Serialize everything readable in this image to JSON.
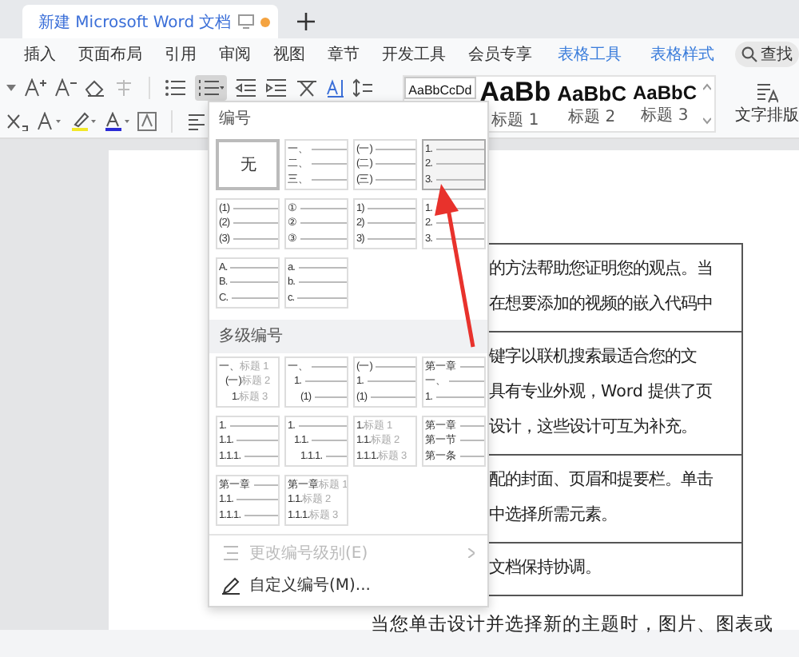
{
  "tab": {
    "title": "新建 Microsoft Word 文档",
    "unsaved": true
  },
  "menu": [
    {
      "label": "插入",
      "kind": "plain"
    },
    {
      "label": "页面布局",
      "kind": "plain"
    },
    {
      "label": "引用",
      "kind": "plain"
    },
    {
      "label": "审阅",
      "kind": "plain"
    },
    {
      "label": "视图",
      "kind": "plain"
    },
    {
      "label": "章节",
      "kind": "plain"
    },
    {
      "label": "开发工具",
      "kind": "plain"
    },
    {
      "label": "会员专享",
      "kind": "plain"
    },
    {
      "label": "表格工具",
      "kind": "context"
    },
    {
      "label": "表格样式",
      "kind": "context"
    }
  ],
  "search": {
    "label": "查找"
  },
  "toolbar": {
    "numbering_open": true
  },
  "styles": [
    {
      "sample": "AaBbCcDd",
      "kind": "normal",
      "selected": true
    },
    {
      "sample": "AaBb",
      "name": "标题 1",
      "kind": "h1",
      "selected": false
    },
    {
      "sample": "AaBbC",
      "name": "标题 2",
      "kind": "h2",
      "selected": false
    },
    {
      "sample": "AaBbC",
      "name": "标题 3",
      "kind": "h3",
      "selected": false
    }
  ],
  "text_layout": {
    "label": "文字排版"
  },
  "numbering_menu": {
    "title": "编号",
    "presets": [
      {
        "kind": "none",
        "label": "无",
        "selected": true,
        "hovered": false
      },
      {
        "kind": "list",
        "lines": [
          "一、",
          "二、",
          "三、"
        ],
        "selected": false,
        "hovered": false
      },
      {
        "kind": "list",
        "lines": [
          "(一)",
          "(二)",
          "(三)"
        ],
        "selected": false,
        "hovered": false
      },
      {
        "kind": "list",
        "lines": [
          "1.",
          "2.",
          "3."
        ],
        "selected": false,
        "hovered": true
      },
      {
        "kind": "list",
        "lines": [
          "(1)",
          "(2)",
          "(3)"
        ],
        "selected": false,
        "hovered": false
      },
      {
        "kind": "list",
        "lines": [
          "①",
          "②",
          "③"
        ],
        "selected": false,
        "hovered": false
      },
      {
        "kind": "list",
        "lines": [
          "1)",
          "2)",
          "3)"
        ],
        "selected": false,
        "hovered": false
      },
      {
        "kind": "list",
        "lines": [
          "1.",
          "2.",
          "3."
        ],
        "selected": false,
        "hovered": false
      },
      {
        "kind": "list",
        "lines": [
          "A.",
          "B.",
          "C."
        ],
        "selected": false,
        "hovered": false
      },
      {
        "kind": "list",
        "lines": [
          "a.",
          "b.",
          "c."
        ],
        "selected": false,
        "hovered": false
      }
    ],
    "multilevel_title": "多级编号",
    "multilevel": [
      {
        "kind": "stepped",
        "lines": [
          {
            "prefix": "一、",
            "label": "标题 1"
          },
          {
            "prefix": "(一)",
            "label": "标题 2"
          },
          {
            "prefix": "1.",
            "label": "标题 3"
          }
        ]
      },
      {
        "kind": "stepped",
        "lines": [
          {
            "prefix": "一、"
          },
          {
            "prefix": "1."
          },
          {
            "prefix": "(1)"
          }
        ]
      },
      {
        "kind": "flat",
        "lines": [
          {
            "prefix": "(一)"
          },
          {
            "prefix": "1."
          },
          {
            "prefix": "(1)"
          }
        ]
      },
      {
        "kind": "flat",
        "lines": [
          {
            "prefix": "第一章"
          },
          {
            "prefix": "一、"
          },
          {
            "prefix": "1."
          }
        ]
      },
      {
        "kind": "flat",
        "lines": [
          {
            "prefix": "1."
          },
          {
            "prefix": "1.1."
          },
          {
            "prefix": "1.1.1."
          }
        ]
      },
      {
        "kind": "stepped",
        "lines": [
          {
            "prefix": "1."
          },
          {
            "prefix": "1.1."
          },
          {
            "prefix": "1.1.1."
          }
        ]
      },
      {
        "kind": "flat",
        "lines": [
          {
            "prefix": "1.",
            "label": "标题 1"
          },
          {
            "prefix": "1.1.",
            "label": "标题 2"
          },
          {
            "prefix": "1.1.1.",
            "label": "标题 3"
          }
        ]
      },
      {
        "kind": "flat",
        "lines": [
          {
            "prefix": "第一章"
          },
          {
            "prefix": "第一节"
          },
          {
            "prefix": "第一条"
          }
        ]
      },
      {
        "kind": "flat",
        "lines": [
          {
            "prefix": "第一章"
          },
          {
            "prefix": "1.1."
          },
          {
            "prefix": "1.1.1."
          }
        ]
      },
      {
        "kind": "flat",
        "lines": [
          {
            "prefix": "第一章",
            "label": "标题 1"
          },
          {
            "prefix": "1.1.",
            "label": "标题 2"
          },
          {
            "prefix": "1.1.1.",
            "label": "标题 3"
          }
        ]
      }
    ],
    "actions": [
      {
        "kind": "level",
        "label": "更改编号级别(E)",
        "disabled": true
      },
      {
        "kind": "custom",
        "label": "自定义编号(M)...",
        "disabled": false
      }
    ]
  },
  "document": {
    "rows": [
      {
        "lines": [
          "的方法帮助您证明您的观点。当",
          "在想要添加的视频的嵌入代码中"
        ]
      },
      {
        "lines": [
          "键字以联机搜索最适合您的文",
          "具有专业外观，Word 提供了页",
          "设计，这些设计可互为补充。"
        ]
      },
      {
        "lines": [
          "配的封面、页眉和提要栏。单击",
          "中选择所需元素。"
        ]
      },
      {
        "lines": [
          "文档保持协调。"
        ]
      }
    ],
    "trailing_line": "当您单击设计并选择新的主题时，图片、图表或"
  }
}
